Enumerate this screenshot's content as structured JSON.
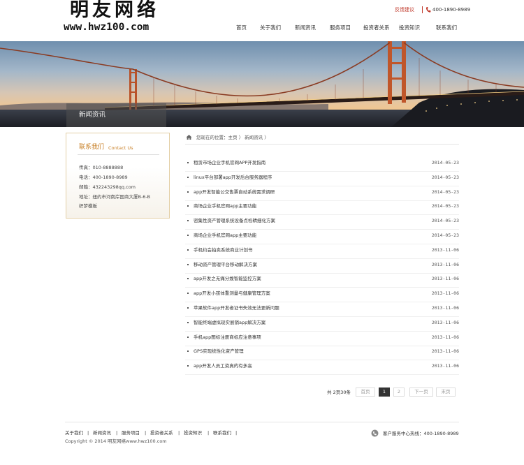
{
  "header": {
    "logo_cn": "明友网络",
    "logo_url": "www.hwz100.com",
    "feedback_label": "反馈建议",
    "phone": "400-1890-8989",
    "nav": [
      {
        "label": "首页"
      },
      {
        "label": "关于我们"
      },
      {
        "label": "新闻资讯"
      },
      {
        "label": "服务项目"
      },
      {
        "label": "投资者关系"
      },
      {
        "label": "投资知识"
      },
      {
        "label": "联系我们"
      }
    ]
  },
  "banner": {
    "label": "新闻资讯"
  },
  "sidebar": {
    "title_cn": "联系我们",
    "title_en": "Contact Us",
    "lines": [
      "传真：010-8888888",
      "电话：400-1890-8989",
      "邮箱：432243298qq.com",
      "地址：纽约市河南岸国商大厦B-6-B",
      "织梦模板"
    ]
  },
  "breadcrumb": {
    "text": "您现在的位置：主页 〉 新闻资讯 〉"
  },
  "news": [
    {
      "title": "租赁市场企业手机官网APP开发指南",
      "date": "2014-05-23"
    },
    {
      "title": "linux平台部署app开发后台服务器程序",
      "date": "2014-05-23"
    },
    {
      "title": "app开发智能公交售票自动系统需求调研",
      "date": "2014-05-23"
    },
    {
      "title": "商场企业手机官网app主要功能",
      "date": "2014-05-23"
    },
    {
      "title": "密集性资产管理系统设备点检精细化方案",
      "date": "2014-05-23"
    },
    {
      "title": "商场企业手机官网app主要功能",
      "date": "2014-05-23"
    },
    {
      "title": "手机约会拍卖系统商业计划书",
      "date": "2013-11-06"
    },
    {
      "title": "移动资产管理平台移动解决方案",
      "date": "2013-11-06"
    },
    {
      "title": "app开发之无痛分娩智能监控方案",
      "date": "2013-11-06"
    },
    {
      "title": "app开发小孩体重测量与健康管理方案",
      "date": "2013-11-06"
    },
    {
      "title": "苹果软件app开发者证书失效无法更新问题",
      "date": "2013-11-06"
    },
    {
      "title": "智能终端虚拟现实展销app解决方案",
      "date": "2013-11-06"
    },
    {
      "title": "手机app图标注册商标应注意事项",
      "date": "2013-11-06"
    },
    {
      "title": "GPS实现统性化资产管理",
      "date": "2013-11-06"
    },
    {
      "title": "app开发人员工资真的有多高",
      "date": "2013-11-06"
    }
  ],
  "pagination": {
    "total": "共 2页30条",
    "first": "首页",
    "page1": "1",
    "page2": "2",
    "next": "下一页",
    "last": "末页"
  },
  "footer": {
    "links": [
      "关于我们",
      "新闻资讯",
      "服务项目",
      "投资者关系",
      "投资知识",
      "联系我们"
    ],
    "separator": "|",
    "copyright": "Copyright © 2014 明友网络www.hwz100.com",
    "hotline": "客户服务中心热线：400-1890-8989"
  },
  "colors": {
    "accent": "#c9822a",
    "feedback": "#c0392b",
    "bridge": "#c0562a"
  }
}
